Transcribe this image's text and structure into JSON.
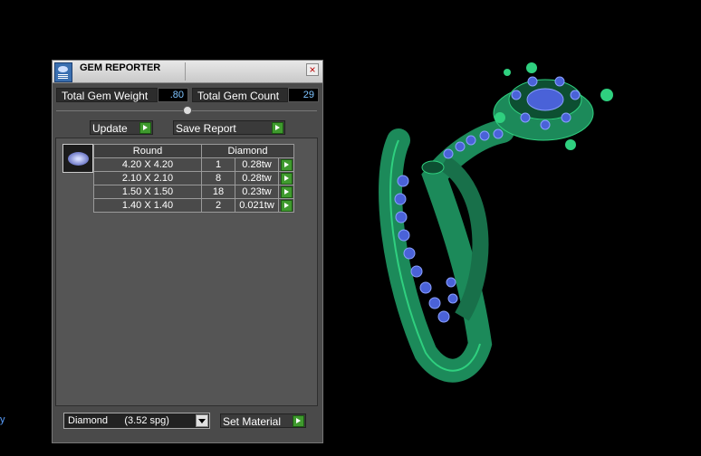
{
  "window": {
    "title": "GEM REPORTER",
    "close_glyph": "×"
  },
  "stats": {
    "weight_label": "Total Gem Weight",
    "weight_value": ".80",
    "count_label": "Total Gem Count",
    "count_value": "29"
  },
  "actions": {
    "update_label": "Update",
    "save_label": "Save Report"
  },
  "table": {
    "shape_header": "Round",
    "material_header": "Diamond",
    "rows": [
      {
        "size": "4.20 X 4.20",
        "count": "1",
        "weight": "0.28tw"
      },
      {
        "size": "2.10 X 2.10",
        "count": "8",
        "weight": "0.28tw"
      },
      {
        "size": "1.50 X 1.50",
        "count": "18",
        "weight": "0.23tw"
      },
      {
        "size": "1.40 X 1.40",
        "count": "2",
        "weight": "0.021tw"
      }
    ]
  },
  "material": {
    "selected": "Diamond      (3.52 spg)",
    "set_label": "Set Material"
  },
  "edge_fragment": "y",
  "colors": {
    "metal": "#1c8a5a",
    "gem": "#4a62d8",
    "accent_go": "#3f9a2e",
    "value_text": "#7ec4ff"
  }
}
